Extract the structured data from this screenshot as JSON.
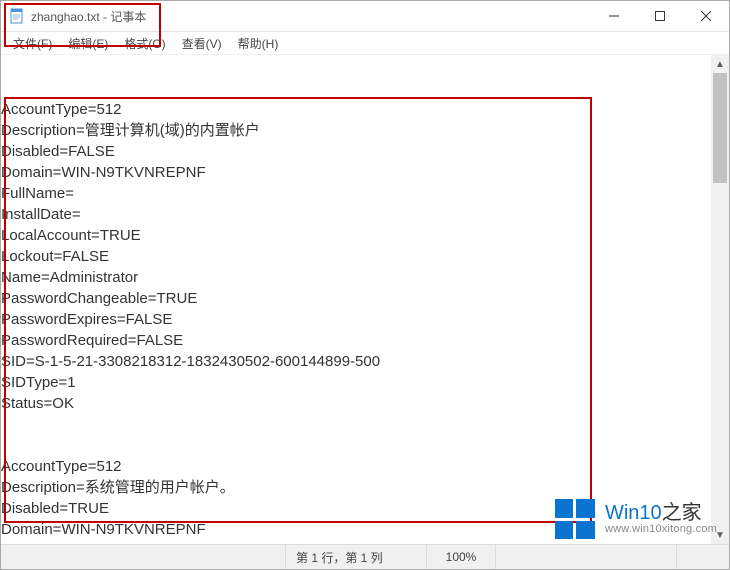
{
  "window": {
    "title": "zhanghao.txt - 记事本"
  },
  "menu": {
    "file": "文件(F)",
    "edit": "编辑(E)",
    "format": "格式(O)",
    "view": "查看(V)",
    "help": "帮助(H)"
  },
  "content": "\n\nAccountType=512\nDescription=管理计算机(域)的内置帐户\nDisabled=FALSE\nDomain=WIN-N9TKVNREPNF\nFullName=\nInstallDate=\nLocalAccount=TRUE\nLockout=FALSE\nName=Administrator\nPasswordChangeable=TRUE\nPasswordExpires=FALSE\nPasswordRequired=FALSE\nSID=S-1-5-21-3308218312-1832430502-600144899-500\nSIDType=1\nStatus=OK\n\n\nAccountType=512\nDescription=系统管理的用户帐户。\nDisabled=TRUE\nDomain=WIN-N9TKVNREPNF",
  "status": {
    "position": "第 1 行，第 1 列",
    "zoom": "100%"
  },
  "watermark": {
    "brand_prefix": "Win10",
    "brand_suffix": "之家",
    "url": "www.win10xitong.com"
  }
}
